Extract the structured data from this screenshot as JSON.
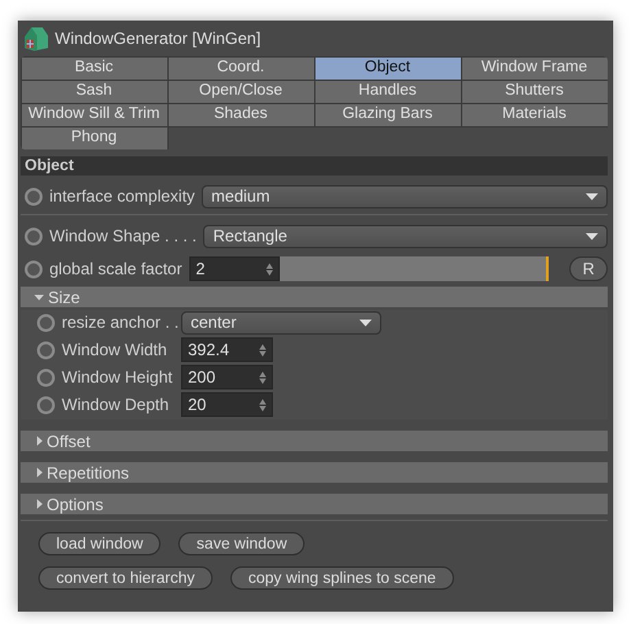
{
  "window": {
    "title": "WindowGenerator [WinGen]"
  },
  "tabs": [
    {
      "label": "Basic",
      "selected": false
    },
    {
      "label": "Coord.",
      "selected": false
    },
    {
      "label": "Object",
      "selected": true
    },
    {
      "label": "Window Frame",
      "selected": false
    },
    {
      "label": "Sash",
      "selected": false
    },
    {
      "label": "Open/Close",
      "selected": false
    },
    {
      "label": "Handles",
      "selected": false
    },
    {
      "label": "Shutters",
      "selected": false
    },
    {
      "label": "Window Sill & Trim",
      "selected": false
    },
    {
      "label": "Shades",
      "selected": false
    },
    {
      "label": "Glazing Bars",
      "selected": false
    },
    {
      "label": "Materials",
      "selected": false
    },
    {
      "label": "Phong",
      "selected": false
    }
  ],
  "section": {
    "title": "Object"
  },
  "parameters": [
    {
      "kind": "dropdown",
      "label": "interface complexity",
      "value": "medium",
      "separator": true
    },
    {
      "kind": "dropdown",
      "label": "Window Shape . . . .",
      "value": "Rectangle"
    },
    {
      "kind": "slider",
      "label": "global scale factor",
      "value": "2",
      "level": 1,
      "reset": "R"
    }
  ],
  "groups": [
    {
      "title": "Size",
      "expanded": true,
      "parameters": [
        {
          "kind": "dropdown",
          "label": "resize anchor . .",
          "value": "center"
        },
        {
          "kind": "number",
          "label": "Window Width",
          "value": "392.4"
        },
        {
          "kind": "number",
          "label": "Window Height",
          "value": "200"
        },
        {
          "kind": "number",
          "label": "Window Depth",
          "value": "20"
        }
      ]
    },
    {
      "title": "Offset",
      "expanded": false
    },
    {
      "title": "Repetitions",
      "expanded": false
    },
    {
      "title": "Options",
      "expanded": false
    }
  ],
  "button_rows": [
    {
      "buttons": [
        "load window",
        "save window"
      ]
    },
    {
      "buttons": [
        "convert to hierarchy",
        "copy wing splines to scene"
      ]
    }
  ]
}
